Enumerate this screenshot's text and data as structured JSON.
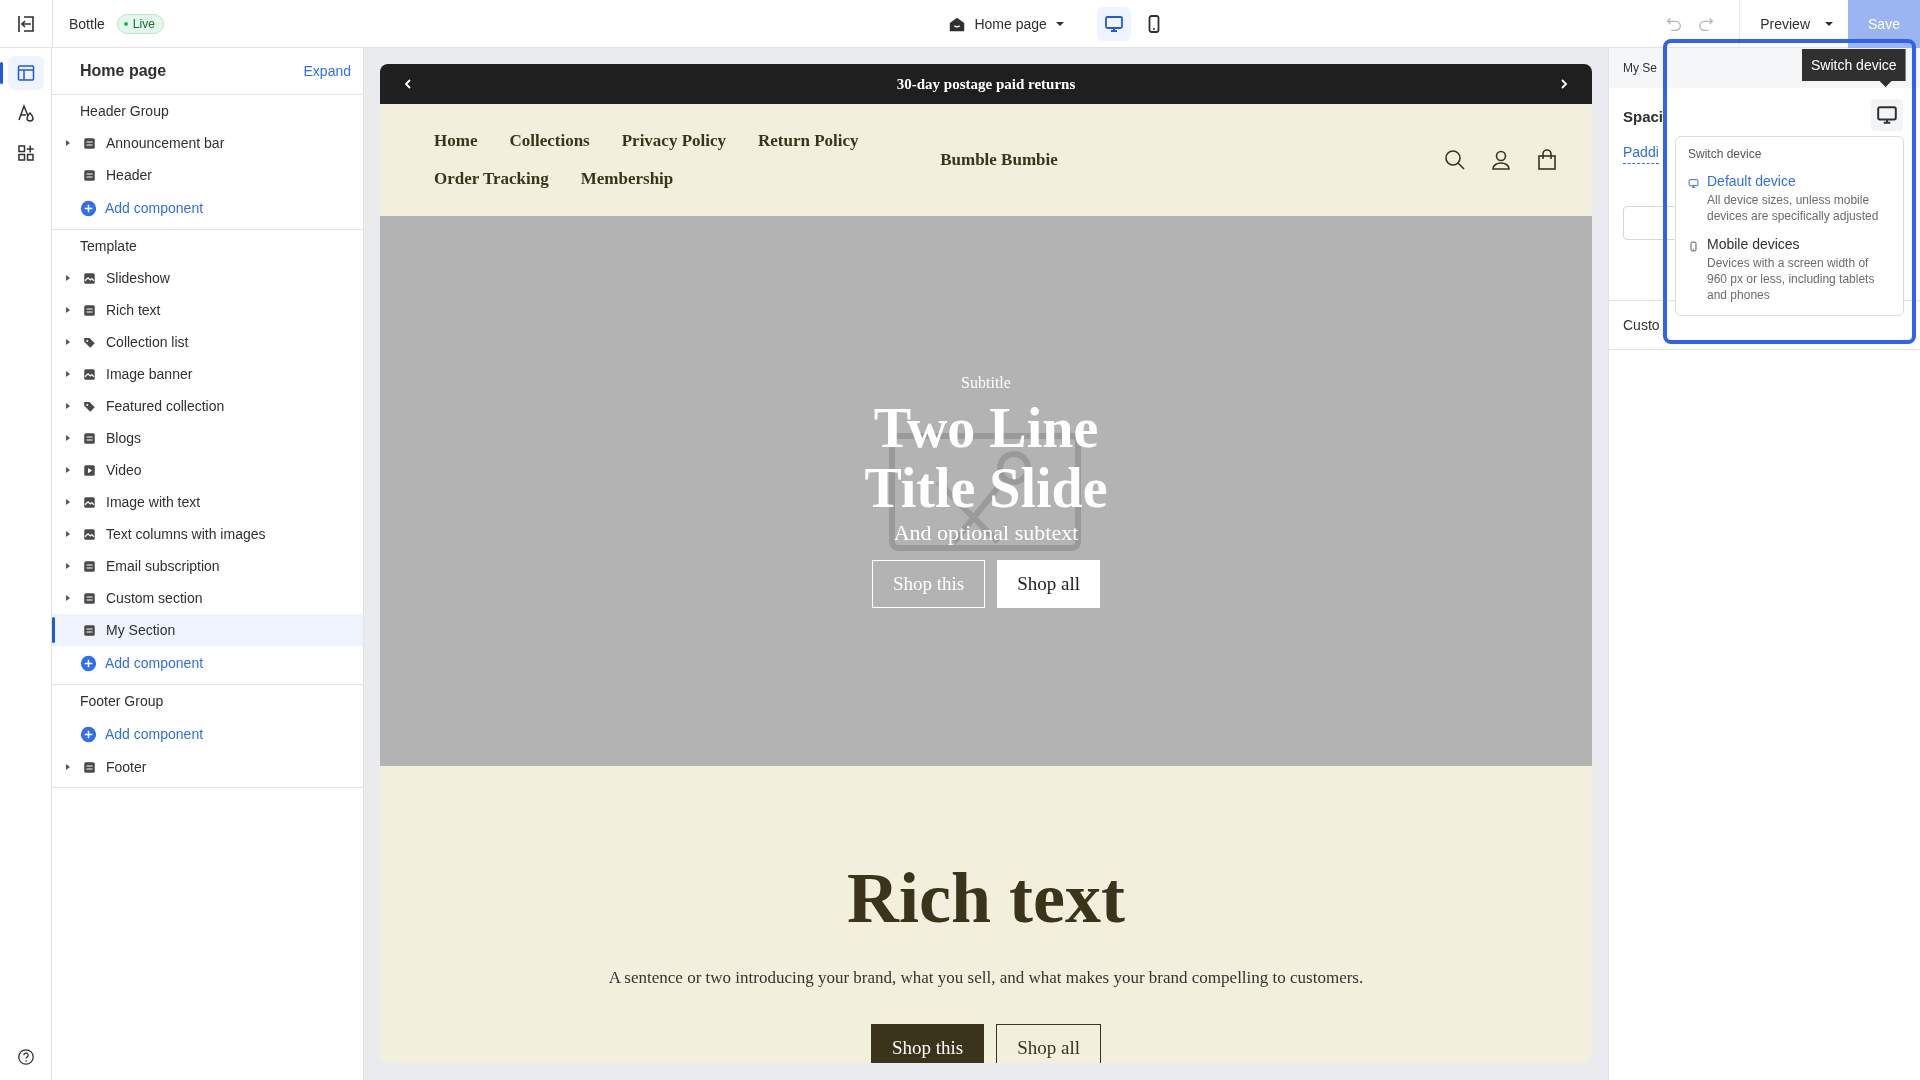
{
  "topbar": {
    "store_name": "Bottle",
    "status": "Live",
    "page_selector": "Home page",
    "devices": [
      {
        "kind": "desktop",
        "selected": true
      },
      {
        "kind": "mobile",
        "selected": false
      }
    ],
    "preview": "Preview",
    "save": {
      "label": "Save",
      "disabled": true
    }
  },
  "rail": [
    {
      "kind": "sections",
      "selected": true
    },
    {
      "kind": "theme",
      "selected": false
    },
    {
      "kind": "apps",
      "selected": false
    }
  ],
  "sidebar": {
    "title": "Home page",
    "action": "Expand",
    "groups": [
      {
        "title": "Header Group",
        "entries": [
          {
            "kind": "item",
            "label": "Announcement bar",
            "expandable": true,
            "selected": false
          },
          {
            "kind": "item",
            "label": "Header",
            "expandable": false,
            "selected": false
          },
          {
            "kind": "add",
            "label": "Add component"
          }
        ]
      },
      {
        "title": "Template",
        "entries": [
          {
            "kind": "item",
            "label": "Slideshow",
            "expandable": true,
            "selected": false
          },
          {
            "kind": "item",
            "label": "Rich text",
            "expandable": true,
            "selected": false
          },
          {
            "kind": "item",
            "label": "Collection list",
            "expandable": true,
            "selected": false
          },
          {
            "kind": "item",
            "label": "Image banner",
            "expandable": true,
            "selected": false
          },
          {
            "kind": "item",
            "label": "Featured collection",
            "expandable": true,
            "selected": false
          },
          {
            "kind": "item",
            "label": "Blogs",
            "expandable": true,
            "selected": false
          },
          {
            "kind": "item",
            "label": "Video",
            "expandable": true,
            "selected": false
          },
          {
            "kind": "item",
            "label": "Image with text",
            "expandable": true,
            "selected": false
          },
          {
            "kind": "item",
            "label": "Text columns with images",
            "expandable": true,
            "selected": false
          },
          {
            "kind": "item",
            "label": "Email subscription",
            "expandable": true,
            "selected": false
          },
          {
            "kind": "item",
            "label": "Custom section",
            "expandable": true,
            "selected": false
          },
          {
            "kind": "item",
            "label": "My Section",
            "expandable": false,
            "selected": true
          },
          {
            "kind": "add",
            "label": "Add component"
          }
        ]
      },
      {
        "title": "Footer Group",
        "entries": [
          {
            "kind": "add",
            "label": "Add component"
          },
          {
            "kind": "item",
            "label": "Footer",
            "expandable": true,
            "selected": false
          }
        ]
      }
    ]
  },
  "preview": {
    "announcement": "30-day postage paid returns",
    "nav": [
      "Home",
      "Collections",
      "Privacy Policy",
      "Return Policy",
      "Order Tracking",
      "Membership"
    ],
    "brand": "Bumble Bumbie",
    "hero": {
      "subtitle": "Subtitle",
      "title": "Two Line Title Slide",
      "subtext": "And optional subtext",
      "buttons": [
        {
          "label": "Shop this",
          "kind": "outline"
        },
        {
          "label": "Shop all",
          "kind": "solid"
        }
      ]
    },
    "rich_text": {
      "heading": "Rich text",
      "body": "A sentence or two introducing your brand, what you sell, and what makes your brand compelling to customers.",
      "buttons": [
        {
          "label": "Shop this",
          "kind": "solid"
        },
        {
          "label": "Shop all",
          "kind": "outline"
        }
      ]
    }
  },
  "settings": {
    "section_title": "My Se",
    "spacing": "Spaci",
    "tab": "Paddi",
    "custom_css": "Custo"
  },
  "tooltip": "Switch device",
  "device_menu": {
    "title": "Switch device",
    "options": [
      {
        "kind": "desktop",
        "label": "Default device",
        "description": "All device sizes, unless mobile devices are specifically adjusted",
        "selected": true
      },
      {
        "kind": "mobile",
        "label": "Mobile devices",
        "description": "Devices with a screen width of 960 px or less, including tablets and phones",
        "selected": false
      }
    ]
  }
}
